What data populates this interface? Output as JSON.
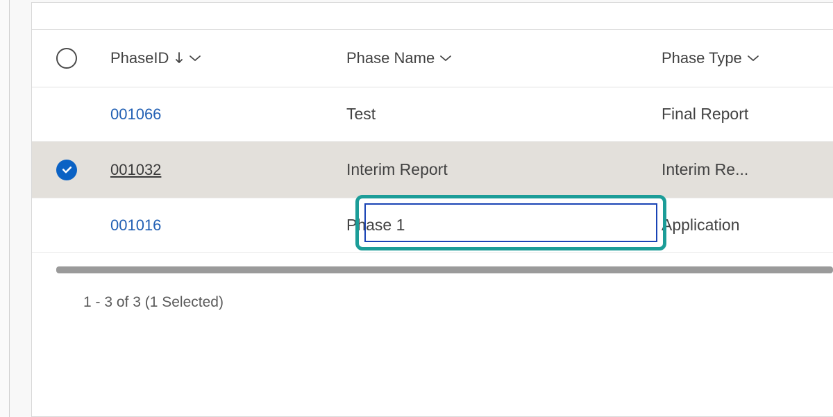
{
  "columns": {
    "phase_id": "PhaseID",
    "phase_name": "Phase Name",
    "phase_type": "Phase Type"
  },
  "rows": [
    {
      "selected": false,
      "id": "001066",
      "name": "Test",
      "type": "Final Report"
    },
    {
      "selected": true,
      "id": "001032",
      "name": "Interim Report",
      "type": "Interim Re..."
    },
    {
      "selected": false,
      "id": "001016",
      "name": "Phase 1",
      "type": "Application"
    }
  ],
  "status": "1 - 3 of 3 (1 Selected)"
}
